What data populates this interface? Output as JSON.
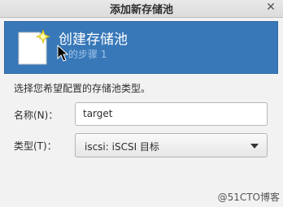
{
  "window": {
    "title": "添加新存储池",
    "close_glyph": "✕"
  },
  "banner": {
    "title": "创建存储池",
    "step": "的步骤 1",
    "icon": "document-new-icon"
  },
  "form": {
    "description": "选择您希望配置的存储池类型。",
    "name_label": "名称(N)：",
    "name_value": "target",
    "type_label": "类型(T)：",
    "type_value": "iscsi: iSCSI 目标"
  },
  "watermark": "@51CTO博客",
  "colors": {
    "banner_bg": "#3878b8",
    "banner_sub": "#9fc3e8"
  }
}
